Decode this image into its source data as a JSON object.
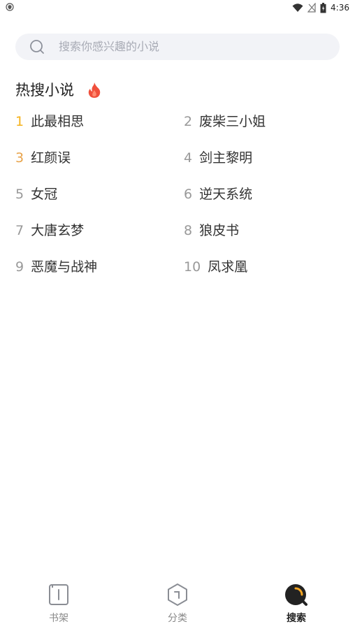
{
  "status_bar": {
    "time": "4:36",
    "left_icon": "shield-icon",
    "icons": [
      "wifi-icon",
      "no-signal-icon",
      "battery-icon"
    ]
  },
  "search": {
    "placeholder": "搜索你感兴趣的小说",
    "icon": "search-icon"
  },
  "hot_section": {
    "title": "热搜小说",
    "icon": "fire-icon",
    "items": [
      {
        "rank": "1",
        "title": "此最相思",
        "rank_color": "#f5b21b"
      },
      {
        "rank": "2",
        "title": "废柴三小姐",
        "rank_color": "#999999"
      },
      {
        "rank": "3",
        "title": "红颜误",
        "rank_color": "#e8a34a"
      },
      {
        "rank": "4",
        "title": "剑主黎明",
        "rank_color": "#999999"
      },
      {
        "rank": "5",
        "title": "女冠",
        "rank_color": "#999999"
      },
      {
        "rank": "6",
        "title": "逆天系统",
        "rank_color": "#999999"
      },
      {
        "rank": "7",
        "title": "大唐玄梦",
        "rank_color": "#999999"
      },
      {
        "rank": "8",
        "title": "狼皮书",
        "rank_color": "#999999"
      },
      {
        "rank": "9",
        "title": "恶魔与战神",
        "rank_color": "#999999"
      },
      {
        "rank": "10",
        "title": "凤求凰",
        "rank_color": "#999999"
      }
    ]
  },
  "bottom_nav": {
    "items": [
      {
        "label": "书架",
        "icon": "bookshelf-icon",
        "active": false
      },
      {
        "label": "分类",
        "icon": "category-icon",
        "active": false
      },
      {
        "label": "搜索",
        "icon": "search-tab-icon",
        "active": true
      }
    ]
  },
  "colors": {
    "accent": "#f5a623",
    "rank_first": "#f5b21b",
    "rank_third": "#e8a34a",
    "fire": "#f0503c",
    "search_bg": "#f2f3f7"
  }
}
